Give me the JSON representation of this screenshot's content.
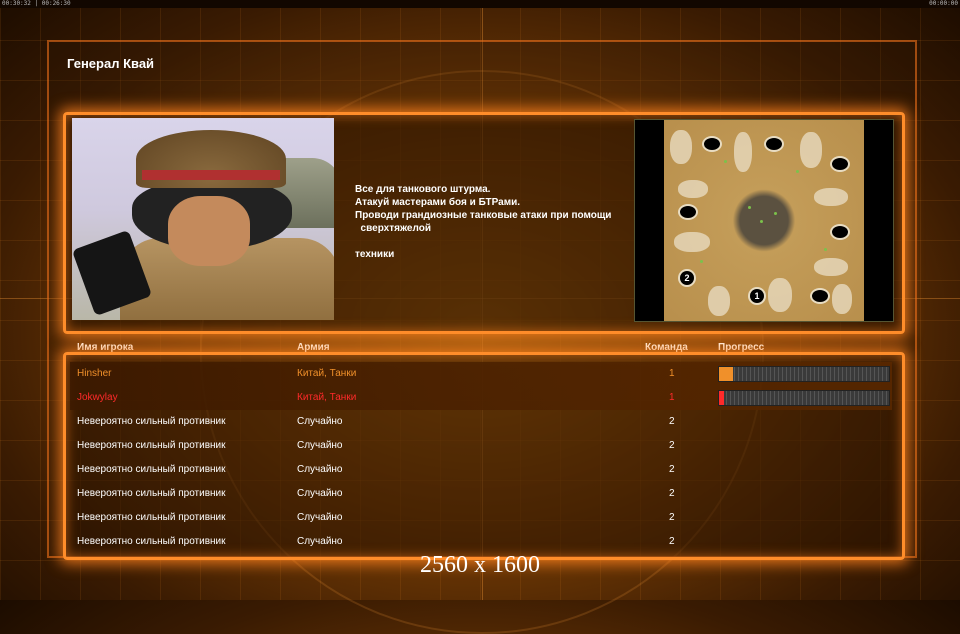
{
  "topbar": {
    "left_time": "00:30:32 | 00:26:30",
    "right_time": "00:00:00"
  },
  "general": {
    "name": "Генерал Квай"
  },
  "briefing": {
    "lines": [
      "Все для танкового штурма.",
      "Атакуй мастерами боя и БТРами.",
      "Проводи грандиозные танковые атаки при помощи",
      "  сверхтяжелой",
      "",
      "техники"
    ]
  },
  "minimap": {
    "start_markers": [
      "1",
      "2"
    ]
  },
  "table": {
    "headers": {
      "name": "Имя игрока",
      "army": "Армия",
      "team": "Команда",
      "progress": "Прогресс"
    },
    "rows": [
      {
        "name": "Hinsher",
        "army": "Китай, Танки",
        "team": "1",
        "progress": 0.08,
        "color": "#f0902a"
      },
      {
        "name": "Jokwylay",
        "army": "Китай, Танки",
        "team": "1",
        "progress": 0.03,
        "color": "#ff2a2a"
      },
      {
        "name": "Невероятно сильный противник",
        "army": "Случайно",
        "team": "2"
      },
      {
        "name": "Невероятно сильный противник",
        "army": "Случайно",
        "team": "2"
      },
      {
        "name": "Невероятно сильный противник",
        "army": "Случайно",
        "team": "2"
      },
      {
        "name": "Невероятно сильный противник",
        "army": "Случайно",
        "team": "2"
      },
      {
        "name": "Невероятно сильный противник",
        "army": "Случайно",
        "team": "2"
      },
      {
        "name": "Невероятно сильный противник",
        "army": "Случайно",
        "team": "2"
      }
    ]
  },
  "resolution_label": "2560 x 1600"
}
